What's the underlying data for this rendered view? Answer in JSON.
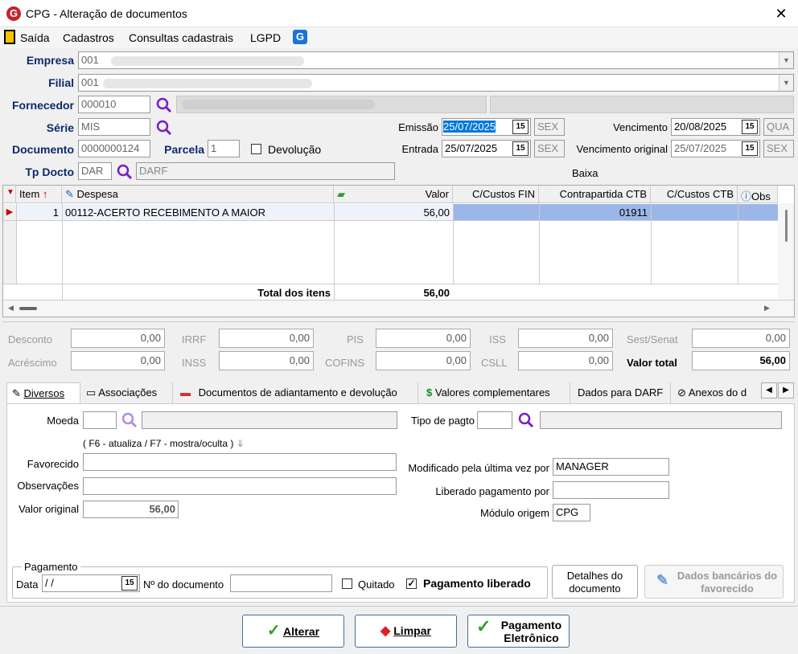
{
  "window": {
    "title": "CPG - Alteração de documentos",
    "close": "✕"
  },
  "menu": [
    "Saída",
    "Cadastros",
    "Consultas cadastrais",
    "LGPD"
  ],
  "form": {
    "empresa_label": "Empresa",
    "empresa_value": "001",
    "filial_label": "Filial",
    "filial_value": "001",
    "fornecedor_label": "Fornecedor",
    "fornecedor_value": "000010",
    "serie_label": "Série",
    "serie_value": "MIS",
    "documento_label": "Documento",
    "documento_value": "0000000124",
    "parcela_label": "Parcela",
    "parcela_value": "1",
    "devolucao_label": "Devolução",
    "tpdocto_label": "Tp Docto",
    "tpdocto_value": "DAR",
    "tpdocto_desc": "DARF",
    "emissao_label": "Emissão",
    "emissao_value": "25/07/2025",
    "emissao_day": "SEX",
    "entrada_label": "Entrada",
    "entrada_value": "25/07/2025",
    "entrada_day": "SEX",
    "vencimento_label": "Vencimento",
    "vencimento_value": "20/08/2025",
    "vencimento_day": "QUA",
    "vencorig_label": "Vencimento original",
    "vencorig_value": "25/07/2025",
    "vencorig_day": "SEX",
    "baixa_label": "Baixa",
    "cal_glyph": "15"
  },
  "grid": {
    "headers": [
      "Item",
      "Despesa",
      "Valor",
      "C/Custos FIN",
      "Contrapartida CTB",
      "C/Custos CTB",
      "Obs"
    ],
    "rows": [
      {
        "item": "1",
        "despesa": "00112-ACERTO RECEBIMENTO A MAIOR",
        "valor": "56,00",
        "contrapartida": "01911"
      }
    ],
    "total_label": "Total dos itens",
    "total_value": "56,00"
  },
  "totals": {
    "desconto_label": "Desconto",
    "desconto": "0,00",
    "acrescimo_label": "Acréscimo",
    "acrescimo": "0,00",
    "irrf_label": "IRRF",
    "irrf": "0,00",
    "inss_label": "INSS",
    "inss": "0,00",
    "pis_label": "PIS",
    "pis": "0,00",
    "cofins_label": "COFINS",
    "cofins": "0,00",
    "iss_label": "ISS",
    "iss": "0,00",
    "csll_label": "CSLL",
    "csll": "0,00",
    "sest_label": "Sest/Senat",
    "sest": "0,00",
    "valortotal_label": "Valor total",
    "valortotal": "56,00"
  },
  "tabs": [
    "Diversos",
    "Associações",
    "Documentos de adiantamento e devolução",
    "Valores complementares",
    "Dados para DARF",
    "Anexos do d"
  ],
  "diversos": {
    "moeda_label": "Moeda",
    "tipopagto_label": "Tipo de pagto",
    "hint": "( F6 - atualiza / F7 - mostra/oculta )",
    "favorecido_label": "Favorecido",
    "observacoes_label": "Observações",
    "valororiginal_label": "Valor original",
    "valororiginal": "56,00",
    "modificado_label": "Modificado pela última vez por",
    "modificado": "MANAGER",
    "liberado_label": "Liberado pagamento por",
    "liberado": "",
    "modulo_label": "Módulo origem",
    "modulo": "CPG",
    "pagamento_group": "Pagamento",
    "data_label": "Data",
    "data_value": " /  /",
    "ndoc_label": "Nº do documento",
    "quitado_label": "Quitado",
    "liberado_chk_label": "Pagamento liberado",
    "detalhes_btn": "Detalhes do documento",
    "dadosbanc_btn": "Dados bancários do favorecido"
  },
  "buttons": {
    "alterar": "Alterar",
    "limpar": "Limpar",
    "pagamento": "Pagamento Eletrônico"
  },
  "colors": {
    "accent": "#0a2a6c",
    "highlight": "#9bb7e8",
    "selected": "#0078d7",
    "logo": "#c8202a",
    "magnifier": "#7a1fc4"
  }
}
